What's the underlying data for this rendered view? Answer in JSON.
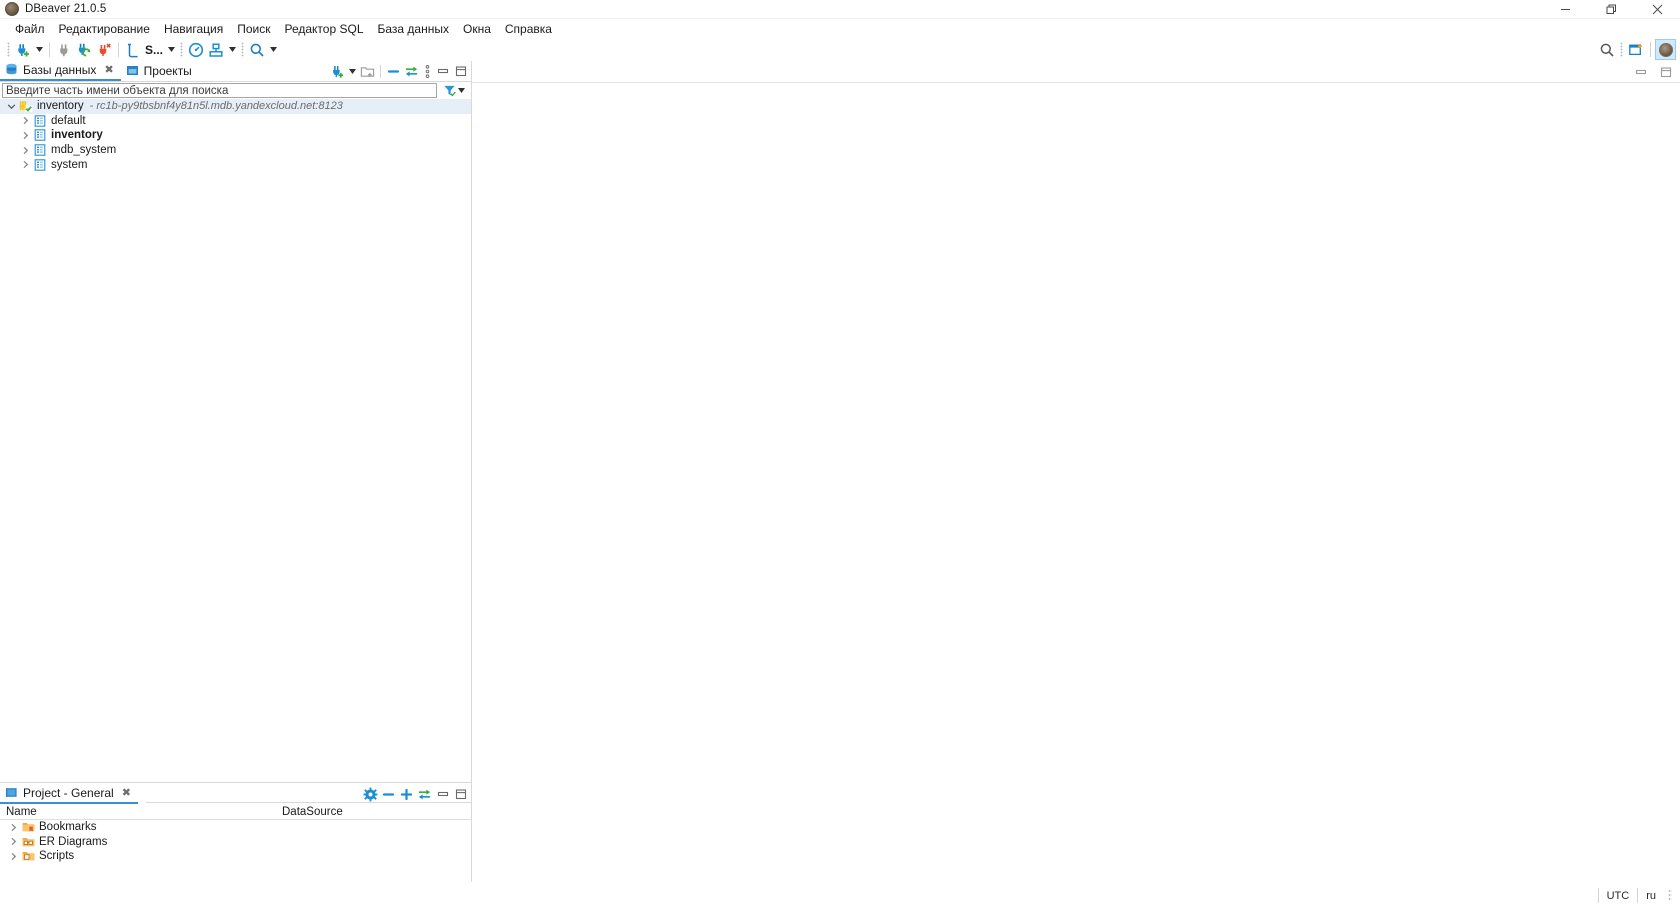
{
  "window": {
    "title": "DBeaver 21.0.5",
    "app_icon": "dbeaver-beaver-icon",
    "controls": {
      "minimize": "minimize-icon",
      "restore": "restore-icon",
      "close": "close-icon"
    }
  },
  "menubar": {
    "items": [
      {
        "label": "Файл",
        "name": "menu-file"
      },
      {
        "label": "Редактирование",
        "name": "menu-edit"
      },
      {
        "label": "Навигация",
        "name": "menu-navigate"
      },
      {
        "label": "Поиск",
        "name": "menu-search"
      },
      {
        "label": "Редактор SQL",
        "name": "menu-sql-editor"
      },
      {
        "label": "База данных",
        "name": "menu-database"
      },
      {
        "label": "Окна",
        "name": "menu-windows"
      },
      {
        "label": "Справка",
        "name": "menu-help"
      }
    ]
  },
  "toolbar": {
    "new_connection": "new-connection-icon",
    "new_connection_dropdown": "chevron-down-icon",
    "disconnect": "disconnect-plug-icon",
    "refresh_connection": "refresh-connection-icon",
    "disconnect_all": "disconnect-all-icon",
    "sql_editor": "sql-editor-icon",
    "sql_editor_label": "S...",
    "sql_editor_dropdown": "chevron-down-icon",
    "dashboard": "dashboard-gauge-icon",
    "data_transfer": "data-transfer-icon",
    "data_transfer_dropdown": "chevron-down-icon",
    "search": "search-icon",
    "search_dropdown": "chevron-down-icon",
    "right_search": "search-icon",
    "perspective_open": "open-perspective-icon",
    "avatar": "user-avatar-icon"
  },
  "navigator": {
    "tabs": [
      {
        "label": "Базы данных",
        "icon": "database-navigator-icon",
        "active": true,
        "closeable": true
      },
      {
        "label": "Проекты",
        "icon": "projects-icon",
        "active": false,
        "closeable": false
      }
    ],
    "tools": [
      {
        "name": "new-connection-button",
        "icon": "new-connection-icon"
      },
      {
        "name": "new-connection-dropdown",
        "icon": "chevron-down-icon"
      },
      {
        "name": "new-folder-button",
        "icon": "new-folder-icon"
      },
      {
        "name": "collapse-all-button",
        "icon": "collapse-all-icon"
      },
      {
        "name": "link-with-editor-button",
        "icon": "link-editor-icon"
      },
      {
        "name": "view-menu-button",
        "icon": "view-menu-icon"
      },
      {
        "name": "minimize-panel-button",
        "icon": "minimize-icon"
      },
      {
        "name": "maximize-panel-button",
        "icon": "maximize-icon"
      }
    ],
    "search": {
      "placeholder": "Введите часть имени объекта для поиска",
      "value": ""
    },
    "filter_icon": "filter-icon",
    "filter_dropdown": "chevron-down-icon",
    "tree": [
      {
        "label": "inventory",
        "sublabel": "- rc1b-py9tbsbnf4y81n5l.mdb.yandexcloud.net:8123",
        "icon": "connection-clickhouse-connected-icon",
        "expanded": true,
        "selected": true,
        "bold": false,
        "indent": 0
      },
      {
        "label": "default",
        "sublabel": "",
        "icon": "database-icon",
        "expanded": false,
        "selected": false,
        "bold": false,
        "indent": 1
      },
      {
        "label": "inventory",
        "sublabel": "",
        "icon": "database-icon",
        "expanded": false,
        "selected": false,
        "bold": true,
        "indent": 1
      },
      {
        "label": "mdb_system",
        "sublabel": "",
        "icon": "database-icon",
        "expanded": false,
        "selected": false,
        "bold": false,
        "indent": 1
      },
      {
        "label": "system",
        "sublabel": "",
        "icon": "database-icon",
        "expanded": false,
        "selected": false,
        "bold": false,
        "indent": 1
      }
    ]
  },
  "project_panel": {
    "tab": {
      "label": "Project - General",
      "icon": "project-icon",
      "closeable": true
    },
    "tools": [
      {
        "name": "configure-columns-button",
        "icon": "gear-icon"
      },
      {
        "name": "collapse-all-button",
        "icon": "collapse-all-icon"
      },
      {
        "name": "expand-all-button",
        "icon": "expand-all-icon"
      },
      {
        "name": "link-with-editor-button",
        "icon": "link-editor-icon"
      },
      {
        "name": "minimize-panel-button",
        "icon": "minimize-icon"
      },
      {
        "name": "maximize-panel-button",
        "icon": "maximize-icon"
      }
    ],
    "columns": [
      {
        "label": "Name",
        "name": "column-name"
      },
      {
        "label": "DataSource",
        "name": "column-datasource"
      }
    ],
    "rows": [
      {
        "label": "Bookmarks",
        "icon": "bookmarks-folder-icon",
        "datasource": ""
      },
      {
        "label": "ER Diagrams",
        "icon": "er-diagrams-folder-icon",
        "datasource": ""
      },
      {
        "label": "Scripts",
        "icon": "scripts-folder-icon",
        "datasource": ""
      }
    ]
  },
  "statusbar": {
    "cells": [
      {
        "label": "UTC",
        "name": "status-timezone"
      },
      {
        "label": "ru",
        "name": "status-locale"
      }
    ]
  },
  "colors": {
    "accent": "#3a8fd4",
    "icon_blue": "#0d7fc4",
    "icon_green": "#3aab3a",
    "icon_orange": "#f0a030",
    "selection": "#e6eef7",
    "border": "#d9d9d9",
    "close_hover": "#e81123"
  }
}
